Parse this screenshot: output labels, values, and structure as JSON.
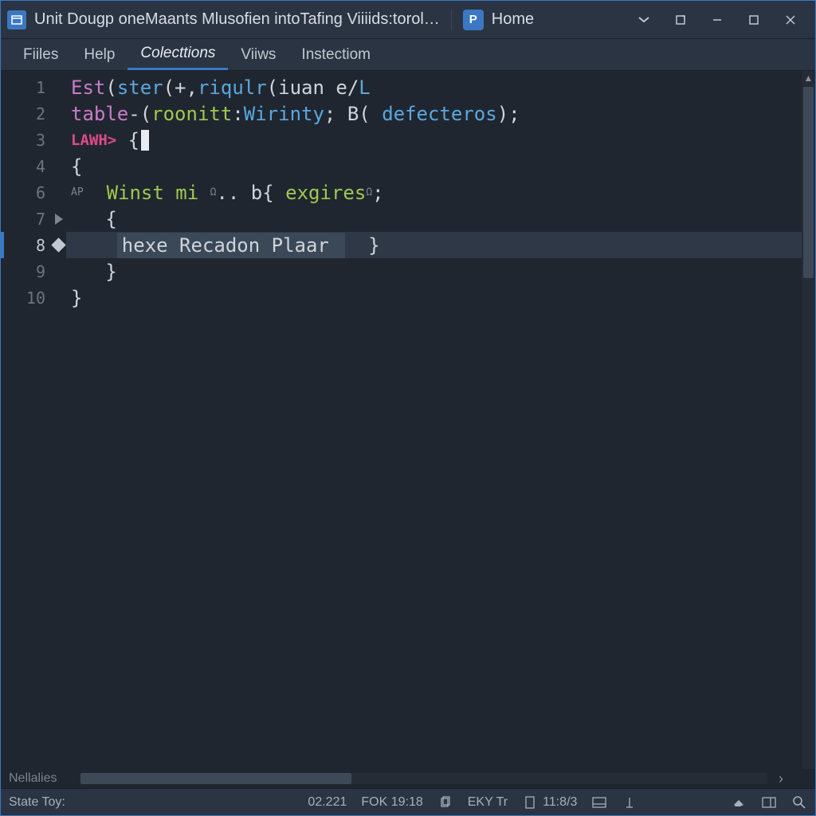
{
  "titlebar": {
    "title": "Unit Dougp oneMaants Mlusofien intoTafing Viiiids:torol…",
    "home_label": "Home",
    "secondary_icon_letter": "P"
  },
  "menubar": {
    "items": [
      {
        "label": "Fiiles",
        "active": false
      },
      {
        "label": "Help",
        "active": false
      },
      {
        "label": "Colecttions",
        "active": true
      },
      {
        "label": "Viiws",
        "active": false
      },
      {
        "label": "Instectiom",
        "active": false
      }
    ]
  },
  "editor": {
    "gutter_numbers": [
      "1",
      "2",
      "3",
      "4",
      "6",
      "7",
      "8",
      "9",
      "10"
    ],
    "active_line_index": 6,
    "fold_marker_index": 5,
    "diamond_marker_index": 6,
    "lines": {
      "l1": {
        "t1": "Est",
        "t2": "(",
        "t3": "ster",
        "t4": "(+,",
        "t5": "riqulr",
        "t6": "(",
        "t7": "iuan e",
        "t8": "/",
        "t9": "L"
      },
      "l2": {
        "t1": "table",
        "t2": "-(",
        "t3": "roonitt",
        "t4": ":",
        "t5": "Wirinty",
        "t6": "; ",
        "t7": "B",
        "t8": "( ",
        "t9": "defecteros",
        "t10": ");"
      },
      "l3": {
        "t1": "LAWH>",
        "t2": " {"
      },
      "l4": {
        "t1": "{"
      },
      "l5": {
        "sup1": "AP",
        "t1": "  ",
        "t2": "Winst mi ",
        "sup2": "Ω",
        "t3": ".. ",
        "t4": "b",
        "t5": "{ ",
        "t6": "exgires",
        "sup3": "Ω",
        "t7": ";"
      },
      "l6": {
        "t1": "   {"
      },
      "l7": {
        "t1": "    ",
        "sel": "hexe Recadon Plaar ",
        "t2": "  }"
      },
      "l8": {
        "t1": "   }"
      },
      "l9": {
        "t1": "}"
      }
    }
  },
  "hscroll": {
    "label": "Nellalies"
  },
  "statusbar": {
    "left": "State Toy:",
    "items": {
      "pos": "02.221",
      "fok": "FOK 19:18",
      "enc": "EKY  Tr",
      "linecol": "11:8/3"
    }
  }
}
